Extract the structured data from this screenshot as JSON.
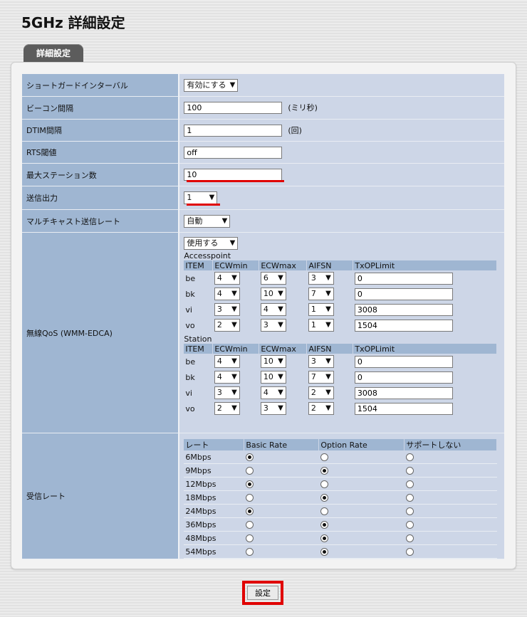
{
  "page": {
    "title": "5GHz 詳細設定",
    "tab_label": "詳細設定"
  },
  "rows": {
    "short_gi": {
      "label": "ショートガードインターバル",
      "value": "有効にする"
    },
    "beacon": {
      "label": "ビーコン間隔",
      "value": "100",
      "unit": "(ミリ秒)"
    },
    "dtim": {
      "label": "DTIM間隔",
      "value": "1",
      "unit": "(回)"
    },
    "rts": {
      "label": "RTS閾値",
      "value": "off"
    },
    "max_sta": {
      "label": "最大ステーション数",
      "value": "10"
    },
    "tx_power": {
      "label": "送信出力",
      "value": "1"
    },
    "mcast": {
      "label": "マルチキャスト送信レート",
      "value": "自動"
    },
    "wmm": {
      "label": "無線QoS (WMM-EDCA)",
      "enable": "使用する",
      "headers": [
        "ITEM",
        "ECWmin",
        "ECWmax",
        "AIFSN",
        "TxOPLimit"
      ],
      "accesspoint": {
        "title": "Accesspoint",
        "rows": [
          {
            "item": "be",
            "ecwmin": "4",
            "ecwmax": "6",
            "aifsn": "3",
            "txop": "0"
          },
          {
            "item": "bk",
            "ecwmin": "4",
            "ecwmax": "10",
            "aifsn": "7",
            "txop": "0"
          },
          {
            "item": "vi",
            "ecwmin": "3",
            "ecwmax": "4",
            "aifsn": "1",
            "txop": "3008"
          },
          {
            "item": "vo",
            "ecwmin": "2",
            "ecwmax": "3",
            "aifsn": "1",
            "txop": "1504"
          }
        ]
      },
      "station": {
        "title": "Station",
        "rows": [
          {
            "item": "be",
            "ecwmin": "4",
            "ecwmax": "10",
            "aifsn": "3",
            "txop": "0"
          },
          {
            "item": "bk",
            "ecwmin": "4",
            "ecwmax": "10",
            "aifsn": "7",
            "txop": "0"
          },
          {
            "item": "vi",
            "ecwmin": "3",
            "ecwmax": "4",
            "aifsn": "2",
            "txop": "3008"
          },
          {
            "item": "vo",
            "ecwmin": "2",
            "ecwmax": "3",
            "aifsn": "2",
            "txop": "1504"
          }
        ]
      }
    },
    "rx_rate": {
      "label": "受信レート",
      "headers": [
        "レート",
        "Basic Rate",
        "Option Rate",
        "サポートしない"
      ],
      "rates": [
        {
          "rate": "6Mbps",
          "selected": "basic"
        },
        {
          "rate": "9Mbps",
          "selected": "option"
        },
        {
          "rate": "12Mbps",
          "selected": "basic"
        },
        {
          "rate": "18Mbps",
          "selected": "option"
        },
        {
          "rate": "24Mbps",
          "selected": "basic"
        },
        {
          "rate": "36Mbps",
          "selected": "option"
        },
        {
          "rate": "48Mbps",
          "selected": "option"
        },
        {
          "rate": "54Mbps",
          "selected": "option"
        }
      ]
    }
  },
  "submit_label": "設定",
  "colors": {
    "label_bg": "#9fb6d2",
    "value_bg": "#cdd6e7",
    "highlight": "#e00000",
    "tab_bg": "#5c5c5c"
  }
}
